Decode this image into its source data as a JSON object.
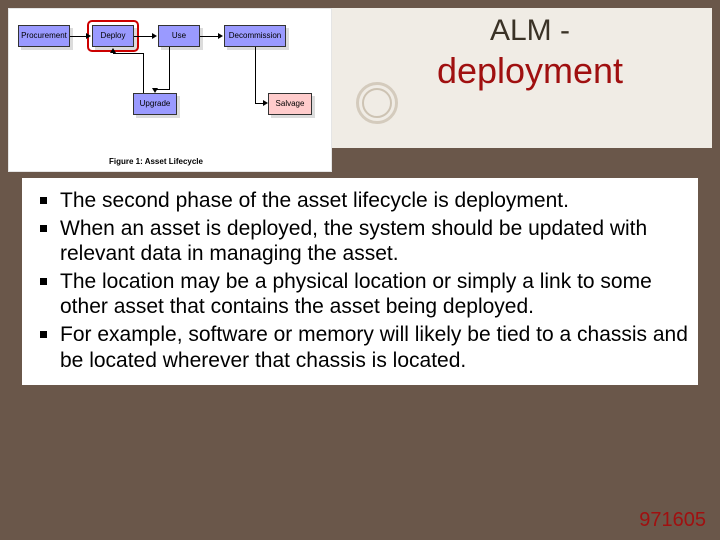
{
  "title": {
    "line1": "ALM -",
    "line2": "deployment"
  },
  "diagram": {
    "nodes": {
      "procurement": "Procurement",
      "deploy": "Deploy",
      "use": "Use",
      "decommission": "Decommission",
      "upgrade": "Upgrade",
      "salvage": "Salvage"
    },
    "caption": "Figure 1: Asset Lifecycle"
  },
  "bullets": [
    "The second phase of the asset lifecycle is deployment.",
    "When an asset is deployed, the system should be updated with relevant data in managing the asset.",
    "The location may be a physical location or simply a link to some other asset that contains the asset being deployed.",
    "For example, software or memory will likely be tied to a chassis and be located wherever that chassis is located."
  ],
  "footer": "971605"
}
